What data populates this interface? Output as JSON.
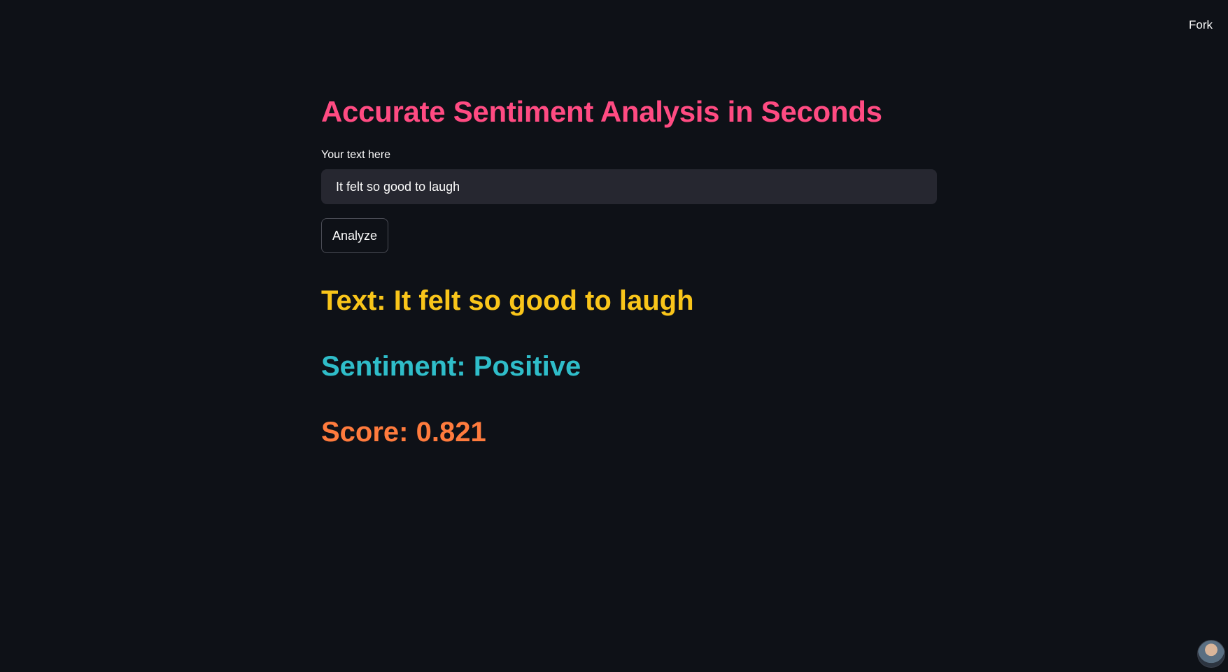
{
  "header": {
    "fork_label": "Fork"
  },
  "app": {
    "title": "Accurate Sentiment Analysis in Seconds",
    "input_label": "Your text here",
    "input_value": "It felt so good to laugh",
    "analyze_label": "Analyze"
  },
  "results": {
    "text_line": "Text: It felt so good to laugh",
    "sentiment_line": "Sentiment: Positive",
    "score_line": "Score: 0.821"
  },
  "colors": {
    "background": "#0e1117",
    "title": "#ff4b82",
    "text_result": "#f9c51a",
    "sentiment_result": "#2fbdc9",
    "score_result": "#ff7b3d",
    "input_background": "#262730"
  },
  "icons": {
    "avatar": "user-avatar-icon"
  }
}
